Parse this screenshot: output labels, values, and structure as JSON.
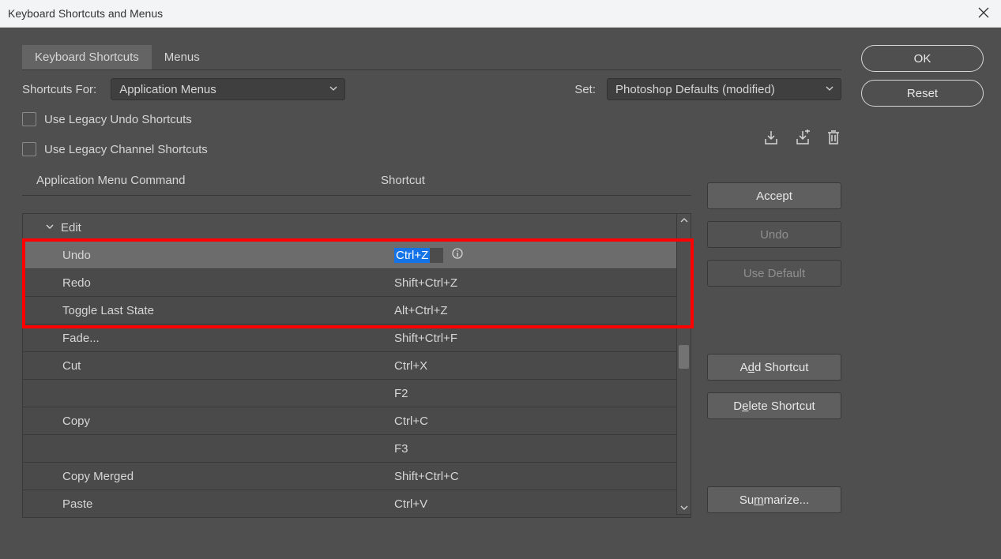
{
  "window": {
    "title": "Keyboard Shortcuts and Menus"
  },
  "side": {
    "ok": "OK",
    "reset": "Reset"
  },
  "tabs": {
    "shortcuts": "Keyboard Shortcuts",
    "menus": "Menus"
  },
  "row1": {
    "shortcuts_for_label": "Shortcuts For:",
    "shortcuts_for_value": "Application Menus",
    "set_label": "Set:",
    "set_value": "Photoshop Defaults (modified)"
  },
  "checks": {
    "legacy_undo": "Use Legacy Undo Shortcuts",
    "legacy_channel": "Use Legacy Channel Shortcuts"
  },
  "headers": {
    "command": "Application Menu Command",
    "shortcut": "Shortcut"
  },
  "rows": {
    "edit": "Edit",
    "undo": "Undo",
    "undo_sc": "Ctrl+Z",
    "redo": "Redo",
    "redo_sc": "Shift+Ctrl+Z",
    "toggle": "Toggle Last State",
    "toggle_sc": "Alt+Ctrl+Z",
    "fade": "Fade...",
    "fade_sc": "Shift+Ctrl+F",
    "cut": "Cut",
    "cut_sc": "Ctrl+X",
    "f2": "F2",
    "copy": "Copy",
    "copy_sc": "Ctrl+C",
    "f3": "F3",
    "copym": "Copy Merged",
    "copym_sc": "Shift+Ctrl+C",
    "paste": "Paste",
    "paste_sc": "Ctrl+V"
  },
  "buttons": {
    "accept": "Accept",
    "undo": "Undo",
    "use_default": "Use Default",
    "add_pre": "A",
    "add_u": "d",
    "add_post": "d Shortcut",
    "del_pre": "D",
    "del_u": "e",
    "del_post": "lete Shortcut",
    "sum_pre": "Su",
    "sum_u": "m",
    "sum_post": "marize..."
  }
}
